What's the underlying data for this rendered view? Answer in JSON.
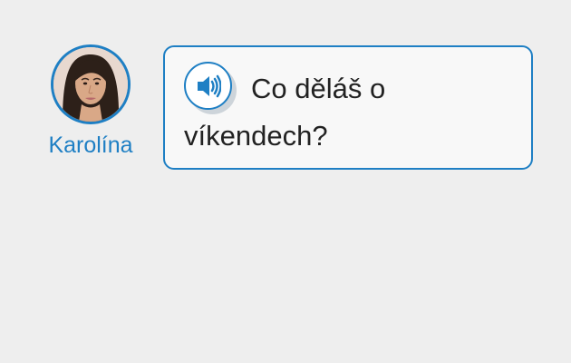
{
  "speaker": {
    "name": "Karolína"
  },
  "message": {
    "text": "Co děláš o víkendech?"
  },
  "colors": {
    "accent": "#1e7fc4",
    "page_background": "#eeeeee",
    "bubble_background": "#f8f8f8",
    "text": "#222222"
  },
  "icons": {
    "audio": "speaker-icon"
  }
}
